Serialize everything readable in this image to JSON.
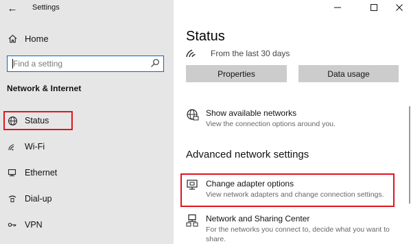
{
  "window": {
    "title": "Settings",
    "back_glyph": "←",
    "minimize_glyph": "—",
    "maximize_glyph": "☐",
    "close_glyph": "✕"
  },
  "sidebar": {
    "home_label": "Home",
    "search_placeholder": "Find a setting",
    "section_title": "Network & Internet",
    "items": [
      {
        "label": "Status",
        "icon": "globe-icon",
        "selected": true
      },
      {
        "label": "Wi-Fi",
        "icon": "wifi-icon"
      },
      {
        "label": "Ethernet",
        "icon": "ethernet-icon"
      },
      {
        "label": "Dial-up",
        "icon": "dialup-icon"
      },
      {
        "label": "VPN",
        "icon": "vpn-icon"
      }
    ]
  },
  "main": {
    "title": "Status",
    "usage_text": "From the last 30 days",
    "buttons": {
      "properties": "Properties",
      "data_usage": "Data usage"
    },
    "show_networks": {
      "title": "Show available networks",
      "desc": "View the connection options around you."
    },
    "advanced_heading": "Advanced network settings",
    "adapter_options": {
      "title": "Change adapter options",
      "desc": "View network adapters and change connection settings."
    },
    "sharing_center": {
      "title": "Network and Sharing Center",
      "desc_line1": "For the networks you connect to, decide what you want to",
      "desc_line2": "share."
    }
  },
  "colors": {
    "sidebar_bg": "#e6e6e6",
    "highlight": "#e0141e",
    "search_border": "#0a64c8",
    "button_bg": "#cccccc"
  }
}
